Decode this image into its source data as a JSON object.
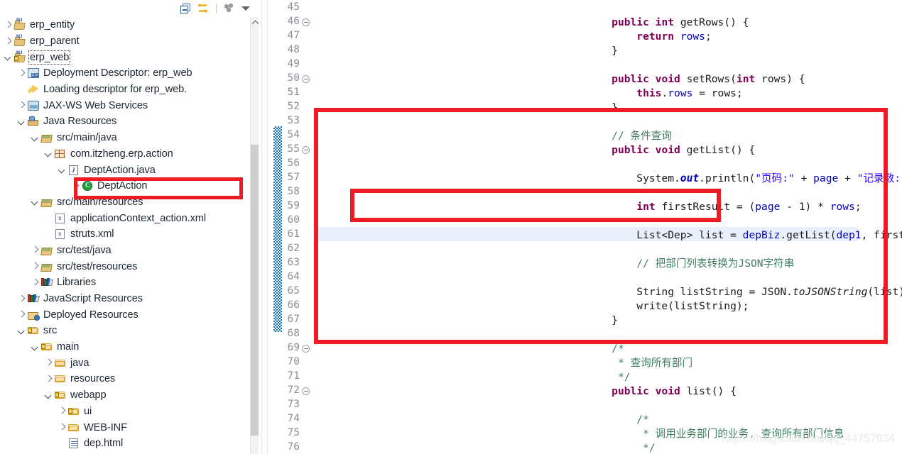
{
  "explorer": {
    "toolbar": [
      {
        "name": "collapse-all-icon",
        "label": "Collapse All"
      },
      {
        "name": "link-with-editor-icon",
        "label": "Link with Editor"
      },
      {
        "name": "view-menu-dots-icon",
        "label": "View Menu"
      },
      {
        "name": "chevron-down-icon",
        "label": "Menu"
      }
    ],
    "tree": [
      {
        "label": "erp_entity",
        "indent": 0,
        "arrow": "closed",
        "icon": "project-icon",
        "focused": false
      },
      {
        "label": "erp_parent",
        "indent": 0,
        "arrow": "closed",
        "icon": "project-icon",
        "focused": false
      },
      {
        "label": "erp_web",
        "indent": 0,
        "arrow": "open",
        "icon": "project-locked-icon",
        "focused": true
      },
      {
        "label": "Deployment Descriptor: erp_web",
        "indent": 1,
        "arrow": "closed",
        "icon": "deployment-descriptor-icon",
        "focused": false
      },
      {
        "label": "Loading descriptor for erp_web.",
        "indent": 1,
        "arrow": "none",
        "icon": "loading-descriptor-icon",
        "focused": false
      },
      {
        "label": "JAX-WS Web Services",
        "indent": 1,
        "arrow": "closed",
        "icon": "web-services-icon",
        "focused": false
      },
      {
        "label": "Java Resources",
        "indent": 1,
        "arrow": "open",
        "icon": "java-resources-icon",
        "focused": false
      },
      {
        "label": "src/main/java",
        "indent": 2,
        "arrow": "open",
        "icon": "source-folder-icon",
        "focused": false
      },
      {
        "label": "com.itzheng.erp.action",
        "indent": 3,
        "arrow": "open",
        "icon": "package-icon",
        "focused": false
      },
      {
        "label": "DeptAction.java",
        "indent": 4,
        "arrow": "open",
        "icon": "java-file-icon",
        "focused": false
      },
      {
        "label": "DeptAction",
        "indent": 5,
        "arrow": "closed",
        "icon": "java-class-icon",
        "focused": false
      },
      {
        "label": "src/main/resources",
        "indent": 2,
        "arrow": "open",
        "icon": "source-folder-icon",
        "focused": false
      },
      {
        "label": "applicationContext_action.xml",
        "indent": 3,
        "arrow": "none",
        "icon": "xml-file-icon",
        "focused": false
      },
      {
        "label": "struts.xml",
        "indent": 3,
        "arrow": "none",
        "icon": "xml-file-icon",
        "focused": false
      },
      {
        "label": "src/test/java",
        "indent": 2,
        "arrow": "closed",
        "icon": "source-folder-icon",
        "focused": false
      },
      {
        "label": "src/test/resources",
        "indent": 2,
        "arrow": "closed",
        "icon": "source-folder-icon",
        "focused": false
      },
      {
        "label": "Libraries",
        "indent": 2,
        "arrow": "closed",
        "icon": "libraries-icon",
        "focused": false
      },
      {
        "label": "JavaScript Resources",
        "indent": 1,
        "arrow": "closed",
        "icon": "libraries-icon",
        "focused": false
      },
      {
        "label": "Deployed Resources",
        "indent": 1,
        "arrow": "closed",
        "icon": "deployed-resources-icon",
        "focused": false
      },
      {
        "label": "src",
        "indent": 1,
        "arrow": "open",
        "icon": "folder-warning-icon",
        "focused": false
      },
      {
        "label": "main",
        "indent": 2,
        "arrow": "open",
        "icon": "folder-warning-icon",
        "focused": false
      },
      {
        "label": "java",
        "indent": 3,
        "arrow": "closed",
        "icon": "folder-icon",
        "focused": false
      },
      {
        "label": "resources",
        "indent": 3,
        "arrow": "closed",
        "icon": "folder-icon",
        "focused": false
      },
      {
        "label": "webapp",
        "indent": 3,
        "arrow": "open",
        "icon": "folder-warning-icon",
        "focused": false
      },
      {
        "label": "ui",
        "indent": 4,
        "arrow": "closed",
        "icon": "folder-warning-icon",
        "focused": false
      },
      {
        "label": "WEB-INF",
        "indent": 4,
        "arrow": "closed",
        "icon": "folder-icon",
        "focused": false
      },
      {
        "label": "dep.html",
        "indent": 4,
        "arrow": "none",
        "icon": "html-file-icon",
        "focused": false
      }
    ]
  },
  "editor": {
    "first_line": 45,
    "current_line": 61,
    "fold_lines": [
      46,
      50,
      55,
      69,
      72
    ],
    "lines": [
      {
        "n": 45,
        "tokens": []
      },
      {
        "n": 46,
        "tokens": [
          {
            "t": "    ",
            "c": "pl"
          },
          {
            "t": "public",
            "c": "k"
          },
          {
            "t": " ",
            "c": "pl"
          },
          {
            "t": "int",
            "c": "k"
          },
          {
            "t": " getRows() {",
            "c": "pl"
          }
        ]
      },
      {
        "n": 47,
        "tokens": [
          {
            "t": "        ",
            "c": "pl"
          },
          {
            "t": "return",
            "c": "k"
          },
          {
            "t": " ",
            "c": "pl"
          },
          {
            "t": "rows",
            "c": "fld"
          },
          {
            "t": ";",
            "c": "pl"
          }
        ]
      },
      {
        "n": 48,
        "tokens": [
          {
            "t": "    }",
            "c": "pl"
          }
        ]
      },
      {
        "n": 49,
        "tokens": []
      },
      {
        "n": 50,
        "tokens": [
          {
            "t": "    ",
            "c": "pl"
          },
          {
            "t": "public",
            "c": "k"
          },
          {
            "t": " ",
            "c": "pl"
          },
          {
            "t": "void",
            "c": "k"
          },
          {
            "t": " setRows(",
            "c": "pl"
          },
          {
            "t": "int",
            "c": "k"
          },
          {
            "t": " rows) {",
            "c": "pl"
          }
        ]
      },
      {
        "n": 51,
        "tokens": [
          {
            "t": "        ",
            "c": "pl"
          },
          {
            "t": "this",
            "c": "k"
          },
          {
            "t": ".",
            "c": "pl"
          },
          {
            "t": "rows",
            "c": "fld"
          },
          {
            "t": " = rows;",
            "c": "pl"
          }
        ]
      },
      {
        "n": 52,
        "tokens": [
          {
            "t": "    }",
            "c": "pl"
          }
        ]
      },
      {
        "n": 53,
        "tokens": []
      },
      {
        "n": 54,
        "tokens": [
          {
            "t": "    ",
            "c": "pl"
          },
          {
            "t": "// 条件查询",
            "c": "cm"
          }
        ]
      },
      {
        "n": 55,
        "tokens": [
          {
            "t": "    ",
            "c": "pl"
          },
          {
            "t": "public",
            "c": "k"
          },
          {
            "t": " ",
            "c": "pl"
          },
          {
            "t": "void",
            "c": "k"
          },
          {
            "t": " getList() {",
            "c": "pl"
          }
        ]
      },
      {
        "n": 56,
        "tokens": []
      },
      {
        "n": 57,
        "tokens": [
          {
            "t": "        System.",
            "c": "pl"
          },
          {
            "t": "out",
            "c": "st"
          },
          {
            "t": ".println(",
            "c": "pl"
          },
          {
            "t": "\"页码:\"",
            "c": "s"
          },
          {
            "t": " + ",
            "c": "pl"
          },
          {
            "t": "page",
            "c": "fld"
          },
          {
            "t": " + ",
            "c": "pl"
          },
          {
            "t": "\"记录数: \"",
            "c": "s"
          },
          {
            "t": " + ",
            "c": "pl"
          },
          {
            "t": "rows",
            "c": "fld"
          },
          {
            "t": ");",
            "c": "pl"
          }
        ]
      },
      {
        "n": 58,
        "tokens": []
      },
      {
        "n": 59,
        "tokens": [
          {
            "t": "        ",
            "c": "pl"
          },
          {
            "t": "int",
            "c": "k"
          },
          {
            "t": " firstResult = (",
            "c": "pl"
          },
          {
            "t": "page",
            "c": "fld"
          },
          {
            "t": " - 1) * ",
            "c": "pl"
          },
          {
            "t": "rows",
            "c": "fld"
          },
          {
            "t": ";",
            "c": "pl"
          }
        ]
      },
      {
        "n": 60,
        "tokens": []
      },
      {
        "n": 61,
        "tokens": [
          {
            "t": "        List<Dep> list = ",
            "c": "pl"
          },
          {
            "t": "depBiz",
            "c": "fld"
          },
          {
            "t": ".getList(",
            "c": "pl"
          },
          {
            "t": "dep1",
            "c": "fld"
          },
          {
            "t": ", firstResult, ",
            "c": "pl"
          },
          {
            "t": "rows",
            "c": "fld"
          },
          {
            "t": ");",
            "c": "pl"
          }
        ]
      },
      {
        "n": 62,
        "tokens": []
      },
      {
        "n": 63,
        "tokens": [
          {
            "t": "        ",
            "c": "pl"
          },
          {
            "t": "// 把部门列表转换为JSON字符串",
            "c": "cm"
          }
        ]
      },
      {
        "n": 64,
        "tokens": []
      },
      {
        "n": 65,
        "tokens": [
          {
            "t": "        String listString = JSON.",
            "c": "pl"
          },
          {
            "t": "toJSONString",
            "c": "sm"
          },
          {
            "t": "(list);",
            "c": "pl"
          }
        ]
      },
      {
        "n": 66,
        "tokens": [
          {
            "t": "        write(listString);",
            "c": "pl"
          }
        ]
      },
      {
        "n": 67,
        "tokens": [
          {
            "t": "    }",
            "c": "pl"
          }
        ]
      },
      {
        "n": 68,
        "tokens": []
      },
      {
        "n": 69,
        "tokens": [
          {
            "t": "    ",
            "c": "pl"
          },
          {
            "t": "/*",
            "c": "cm"
          }
        ]
      },
      {
        "n": 70,
        "tokens": [
          {
            "t": "     ",
            "c": "pl"
          },
          {
            "t": "* 查询所有部门",
            "c": "cm"
          }
        ]
      },
      {
        "n": 71,
        "tokens": [
          {
            "t": "     ",
            "c": "pl"
          },
          {
            "t": "*/",
            "c": "cm"
          }
        ]
      },
      {
        "n": 72,
        "tokens": [
          {
            "t": "    ",
            "c": "pl"
          },
          {
            "t": "public",
            "c": "k"
          },
          {
            "t": " ",
            "c": "pl"
          },
          {
            "t": "void",
            "c": "k"
          },
          {
            "t": " list() {",
            "c": "pl"
          }
        ]
      },
      {
        "n": 73,
        "tokens": []
      },
      {
        "n": 74,
        "tokens": [
          {
            "t": "        ",
            "c": "pl"
          },
          {
            "t": "/*",
            "c": "cm"
          }
        ]
      },
      {
        "n": 75,
        "tokens": [
          {
            "t": "         ",
            "c": "pl"
          },
          {
            "t": "* 调用业务部门的业务, 查询所有部门信息",
            "c": "cm"
          }
        ]
      },
      {
        "n": 76,
        "tokens": [
          {
            "t": "         ",
            "c": "pl"
          },
          {
            "t": "*/",
            "c": "cm"
          }
        ]
      }
    ]
  },
  "annotations": {
    "main_box_label": "highlight-getList-method",
    "inner_box_label": "highlight-firstResult-statement",
    "tree_box_label": "highlight-DeptAction-class"
  },
  "watermark": {
    "text": "https://blog.csdn.net/qq_44757034"
  },
  "colors": {
    "annotation_red": "#ed1c24",
    "keyword": "#7f0055",
    "string": "#2a00ff",
    "comment": "#3f7f5f",
    "field": "#0000c0",
    "current_line": "#e9f0fb",
    "range_indicator": "#0a72c8"
  }
}
